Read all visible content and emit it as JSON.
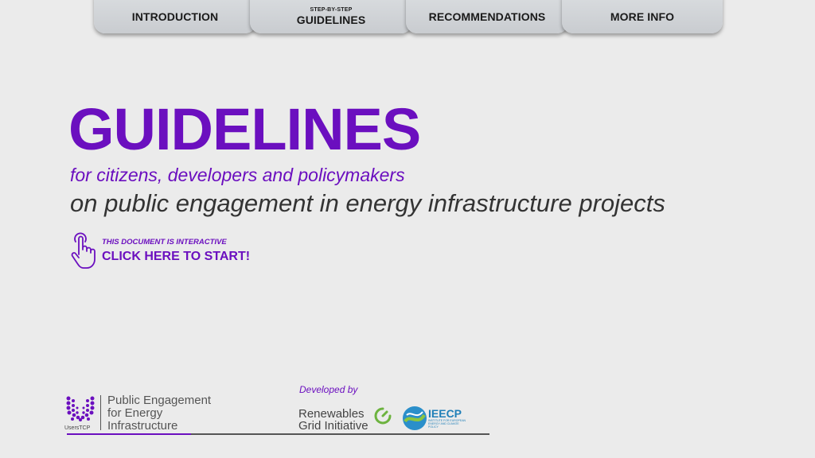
{
  "tabs": [
    {
      "label": "INTRODUCTION",
      "sup": ""
    },
    {
      "label": "GUIDELINES",
      "sup": "STEP-BY-STEP"
    },
    {
      "label": "RECOMMENDATIONS",
      "sup": ""
    },
    {
      "label": "MORE INFO",
      "sup": ""
    }
  ],
  "main": {
    "title": "GUIDELINES",
    "subtitle": "for citizens, developers and policymakers",
    "subtitle2": "on public engagement in energy infrastructure projects",
    "cta_small": "THIS DOCUMENT IS INTERACTIVE",
    "cta_big": "CLICK HERE TO START!"
  },
  "footer": {
    "users_caption": "UsersTCP",
    "pei_line1": "Public Engagement",
    "pei_line2": "for Energy",
    "pei_line3": "Infrastructure",
    "developed_by": "Developed by",
    "rgi_line1": "Renewables",
    "rgi_line2": "Grid Initiative",
    "ieecp": "IEECP",
    "ieecp_sub": "INSTITUTE FOR EUROPEAN ENERGY AND CLIMATE POLICY"
  },
  "colors": {
    "accent": "#6b0fbf",
    "background": "#ebebeb",
    "tab": "#d0d3d6"
  },
  "icons": [
    "hand-pointer-icon",
    "userstcp-logo",
    "rgi-logo-icon",
    "ieecp-logo-icon"
  ]
}
